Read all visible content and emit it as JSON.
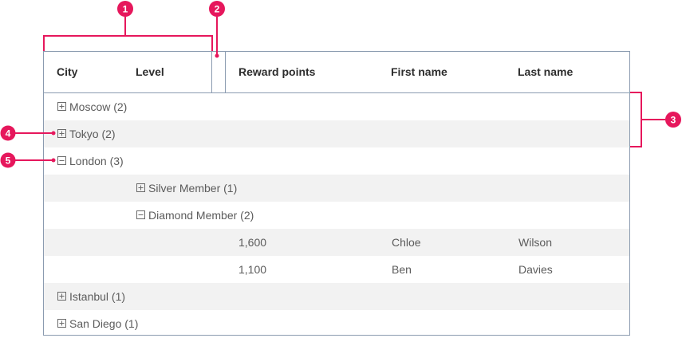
{
  "colors": {
    "callout": "#e6175c",
    "grid_border": "#8b9bb0",
    "alt_row": "#f2f2f2",
    "header_text": "#2d2d2d",
    "cell_text": "#5b5b5b"
  },
  "callouts": [
    "1",
    "2",
    "3",
    "4",
    "5"
  ],
  "grid": {
    "headers": {
      "city": "City",
      "level": "Level",
      "reward_points": "Reward points",
      "first_name": "First name",
      "last_name": "Last name"
    },
    "groups": [
      {
        "label": "Moscow (2)",
        "expanded": false,
        "icon": "plus-square-icon"
      },
      {
        "label": "Tokyo (2)",
        "expanded": false,
        "icon": "plus-square-icon"
      },
      {
        "label": "London (3)",
        "expanded": true,
        "icon": "minus-square-icon",
        "subgroups": [
          {
            "label": "Silver Member (1)",
            "expanded": false,
            "icon": "plus-square-icon"
          },
          {
            "label": "Diamond Member (2)",
            "expanded": true,
            "icon": "minus-square-icon",
            "records": [
              {
                "reward_points": "1,600",
                "first_name": "Chloe",
                "last_name": "Wilson"
              },
              {
                "reward_points": "1,100",
                "first_name": "Ben",
                "last_name": "Davies"
              }
            ]
          }
        ]
      },
      {
        "label": "Istanbul (1)",
        "expanded": false,
        "icon": "plus-square-icon"
      },
      {
        "label": "San Diego (1)",
        "expanded": false,
        "icon": "plus-square-icon"
      }
    ]
  }
}
